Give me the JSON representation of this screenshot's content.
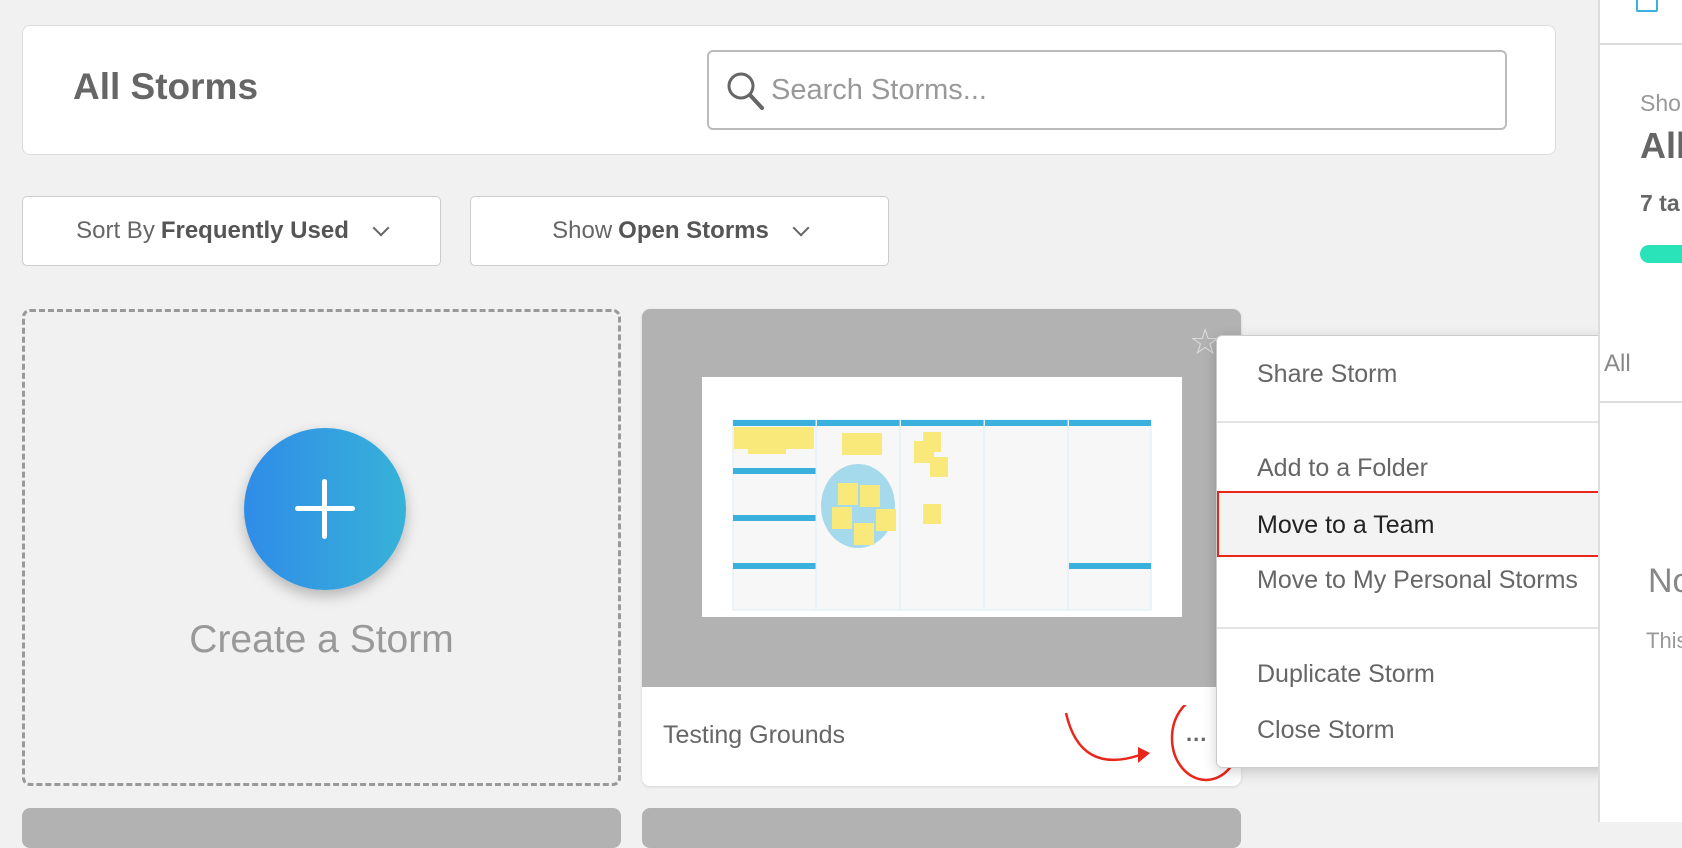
{
  "header": {
    "title": "All Storms",
    "search_placeholder": "Search Storms..."
  },
  "filters": {
    "sort_prefix": "Sort By",
    "sort_value": "Frequently Used",
    "show_prefix": "Show",
    "show_value": "Open Storms"
  },
  "create": {
    "label": "Create a Storm"
  },
  "storm_card": {
    "name": "Testing Grounds",
    "more_label": "...",
    "favorite_icon": "star-icon"
  },
  "menu": {
    "items": [
      "Share Storm",
      "Add to a Folder",
      "Move to a Team",
      "Move to My Personal Storms",
      "Duplicate Storm",
      "Close Storm"
    ],
    "highlighted": "Move to a Team"
  },
  "right_panel": {
    "show_label": "Sho",
    "all_label": "All",
    "count_label": "7 ta",
    "tab_all": "All",
    "empty_title": "No",
    "empty_text": "This",
    "progress_color": "#2ae3b8"
  },
  "colors": {
    "accent": "#2f8ce8",
    "annotation": "#e8261a"
  }
}
